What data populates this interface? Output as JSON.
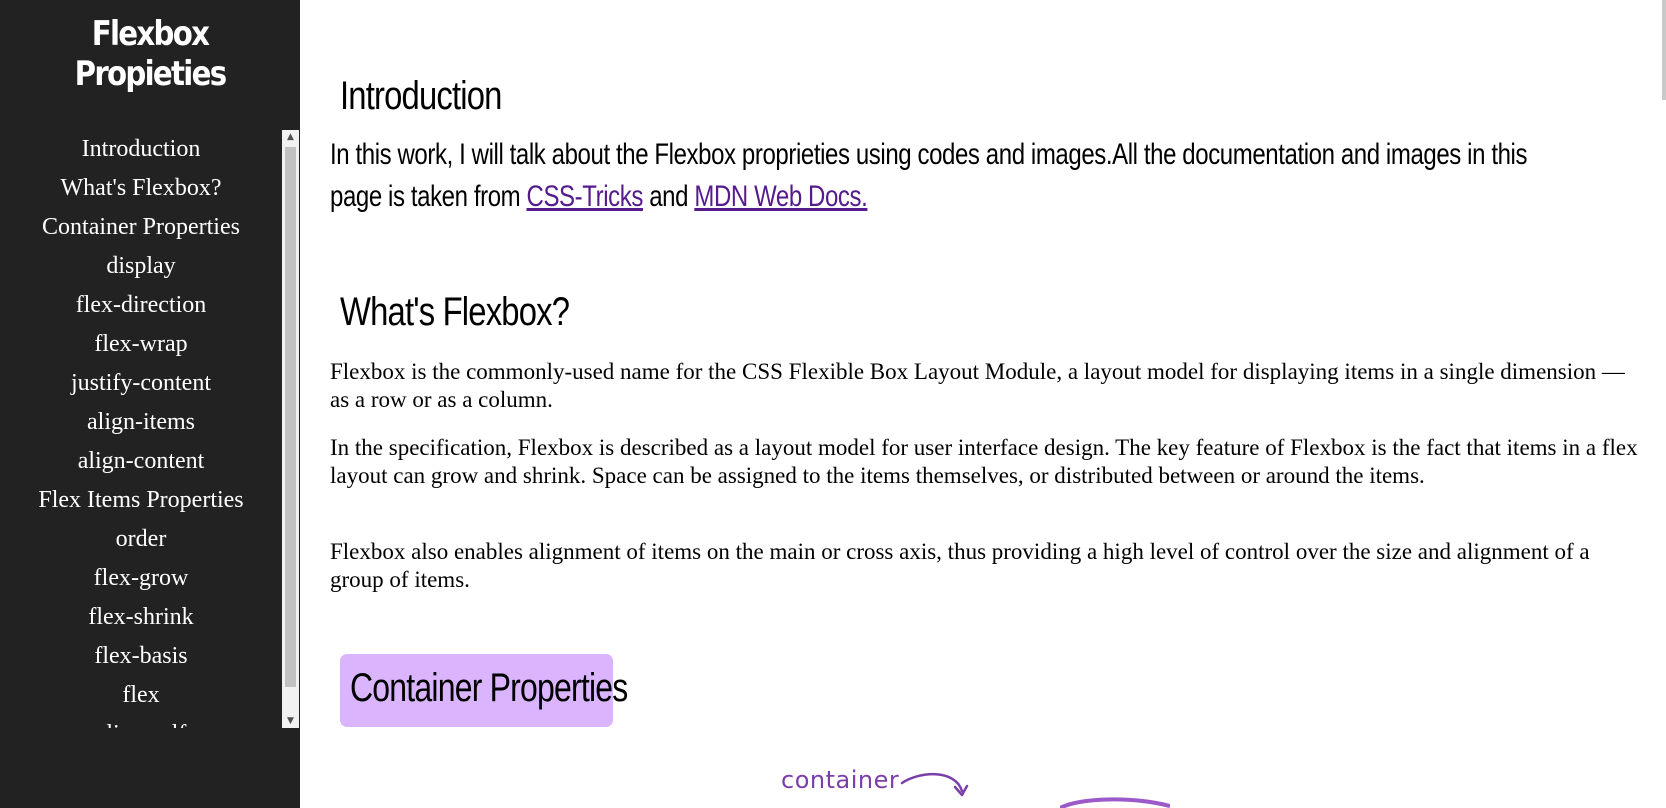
{
  "sidebar": {
    "title": "Flexbox Propieties",
    "items": [
      {
        "label": "Introduction"
      },
      {
        "label": "What's Flexbox?"
      },
      {
        "label": "Container Properties"
      },
      {
        "label": "display"
      },
      {
        "label": "flex-direction"
      },
      {
        "label": "flex-wrap"
      },
      {
        "label": "justify-content"
      },
      {
        "label": "align-items"
      },
      {
        "label": "align-content"
      },
      {
        "label": "Flex Items Properties"
      },
      {
        "label": "order"
      },
      {
        "label": "flex-grow"
      },
      {
        "label": "flex-shrink"
      },
      {
        "label": "flex-basis"
      },
      {
        "label": "flex"
      },
      {
        "label": "align-self"
      }
    ],
    "scroll_up_icon": "triangle-up",
    "scroll_down_icon": "triangle-down"
  },
  "main": {
    "introduction": {
      "heading": "Introduction",
      "text": "In this work, I will talk about the Flexbox proprieties using codes and images.All the documentation and images in this page is taken from",
      "link1": "CSS-Tricks",
      "connector": "and",
      "link2": "MDN Web Docs."
    },
    "whats_flexbox": {
      "heading": "What's Flexbox?",
      "paragraphs": [
        "Flexbox is the commonly-used name for the CSS Flexible Box Layout Module, a layout model for displaying items in a single dimension — as a row or as a column.",
        "In the specification, Flexbox is described as a layout model for user interface design. The key feature of Flexbox is the fact that items in a flex layout can grow and shrink. Space can be assigned to the items themselves, or distributed between or around the items.",
        "Flexbox also enables alignment of items on the main or cross axis, thus providing a high level of control over the size and alignment of a group of items."
      ]
    },
    "container_properties": {
      "heading": "Container Properties",
      "diagram_label": "container"
    }
  },
  "colors": {
    "sidebar_bg": "#222222",
    "link": "#551a8b",
    "heading_box": "#dab4fc",
    "diagram_purple": "#7b3fa8"
  }
}
